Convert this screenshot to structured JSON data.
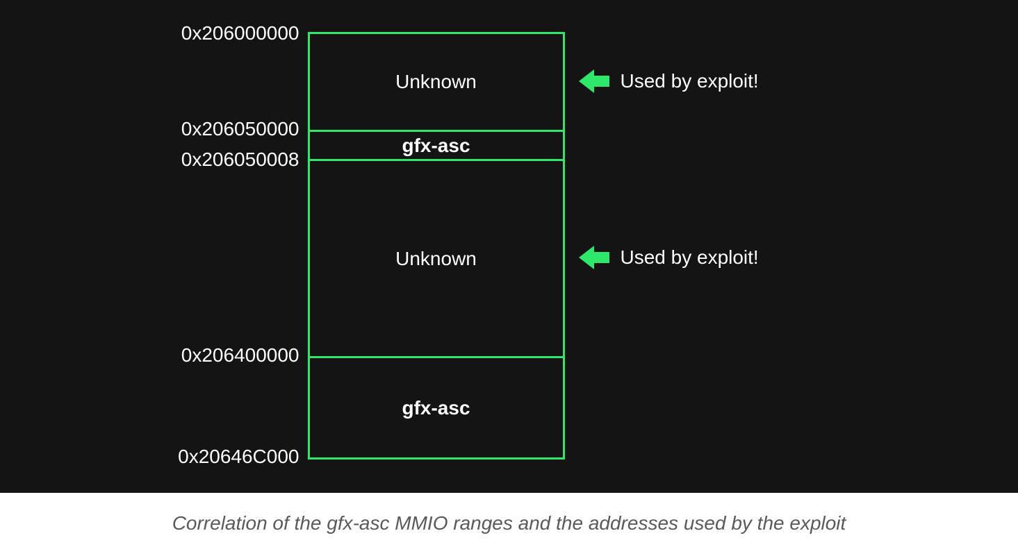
{
  "diagram": {
    "addresses": {
      "a0": "0x206000000",
      "a1": "0x206050000",
      "a2": "0x206050008",
      "a3": "0x206400000",
      "a4": "0x20646C000"
    },
    "regions": {
      "r0": {
        "label": "Unknown",
        "bold": false
      },
      "r1": {
        "label": "gfx-asc",
        "bold": true
      },
      "r2": {
        "label": "Unknown",
        "bold": false
      },
      "r3": {
        "label": "gfx-asc",
        "bold": true
      }
    },
    "annotations": {
      "used_by_exploit": "Used by exploit!"
    }
  },
  "caption": "Correlation of the gfx-asc MMIO ranges and the addresses used by the exploit",
  "colors": {
    "outline": "#2ee86b",
    "panel_bg": "#141414",
    "text": "#ffffff",
    "caption": "#5a5a5a"
  }
}
